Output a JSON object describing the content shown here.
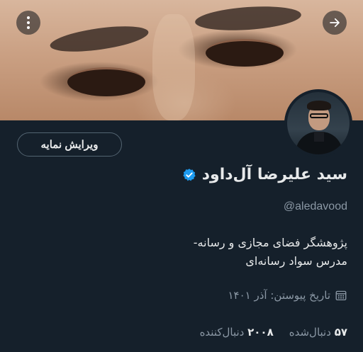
{
  "profile": {
    "name": "سید علیرضا آل‌داود",
    "handle": "@aledavood",
    "bio_line1": "پژوهشگر فضای مجازی و رسانه-",
    "bio_line2": "مدرس سواد رسانه‌ای",
    "joined": "تاریخ پیوستن: آذر ۱۴۰۱",
    "following_count": "۵۷",
    "following_label": "دنبال‌شده",
    "followers_count": "۲۰۰۸",
    "followers_label": "دنبال‌کننده",
    "verified": true
  },
  "actions": {
    "edit_label": "ویرایش نمایه",
    "menu_icon": "more-vertical-icon",
    "back_icon": "arrow-right-icon"
  },
  "colors": {
    "background": "#15202b",
    "verified_badge": "#1d9bf0",
    "secondary_text": "#8b98a5"
  }
}
